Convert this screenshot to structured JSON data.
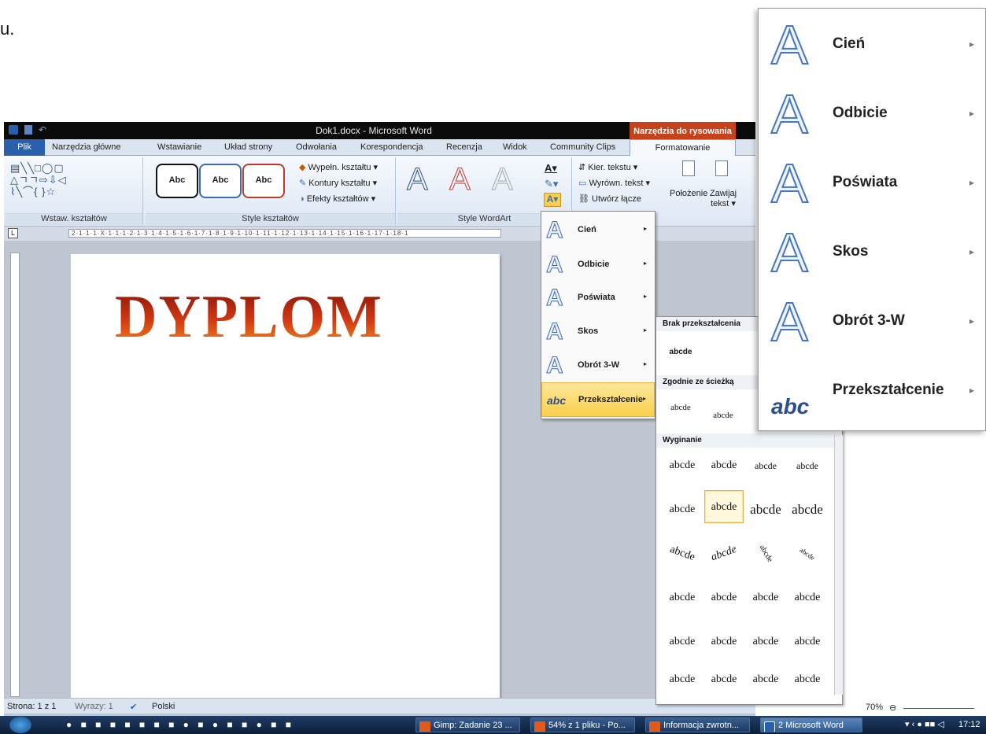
{
  "fragment_text": "u.",
  "window": {
    "title": "Dok1.docx - Microsoft Word",
    "context_tab": "Narzędzia do rysowania"
  },
  "tabs": [
    "Plik",
    "Narzędzia główne",
    "Wstawianie",
    "Układ strony",
    "Odwołania",
    "Korespondencja",
    "Recenzja",
    "Widok",
    "Community Clips",
    "Formatowanie"
  ],
  "ribbon": {
    "group_insert_shapes": "Wstaw. kształtów",
    "group_shape_styles": "Style kształtów",
    "group_wordart": "Style WordArt",
    "shape_style_label": "Abc",
    "fill": "Wypełn. kształtu ▾",
    "outline": "Kontury kształtu ▾",
    "effects": "Efekty kształtów ▾",
    "text_dir": "Kier. tekstu ▾",
    "align_text": "Wyrówn. tekst ▾",
    "create_link": "Utwórz łącze",
    "position": "Położenie",
    "wrap": "Zawijaj tekst ▾",
    "wordart_glyph": "A"
  },
  "document": {
    "wordart": "DYPLOM"
  },
  "menu": {
    "items": [
      {
        "label": "Cień",
        "glyph": "A"
      },
      {
        "label": "Odbicie",
        "glyph": "A"
      },
      {
        "label": "Poświata",
        "glyph": "A"
      },
      {
        "label": "Skos",
        "glyph": "A"
      },
      {
        "label": "Obrót 3-W",
        "glyph": "A"
      },
      {
        "label": "Przekształcenie",
        "glyph": "abc"
      }
    ],
    "arrow": "▸"
  },
  "gallery": {
    "h_none": "Brak przekształcenia",
    "none_sample": "abcde",
    "h_path": "Zgodnie ze ścieżką",
    "h_warp": "Wyginanie",
    "sample": "abcde"
  },
  "status": {
    "page": "Strona: 1 z 1",
    "words": "Wyrazy: 1",
    "lang": "Polski",
    "zoom": "70%"
  },
  "taskbar": {
    "items": [
      "Gimp: Zadanie 23 ...",
      "54% z 1 pliku - Po...",
      "Informacja zwrotn...",
      "2 Microsoft Word"
    ],
    "time": "17:12"
  },
  "colors": {
    "accent": "#2a5fac",
    "context": "#c4431d",
    "highlight": "#fbcf4b",
    "wordart_top": "#7a0d05",
    "wordart_bottom": "#f39a1e"
  }
}
